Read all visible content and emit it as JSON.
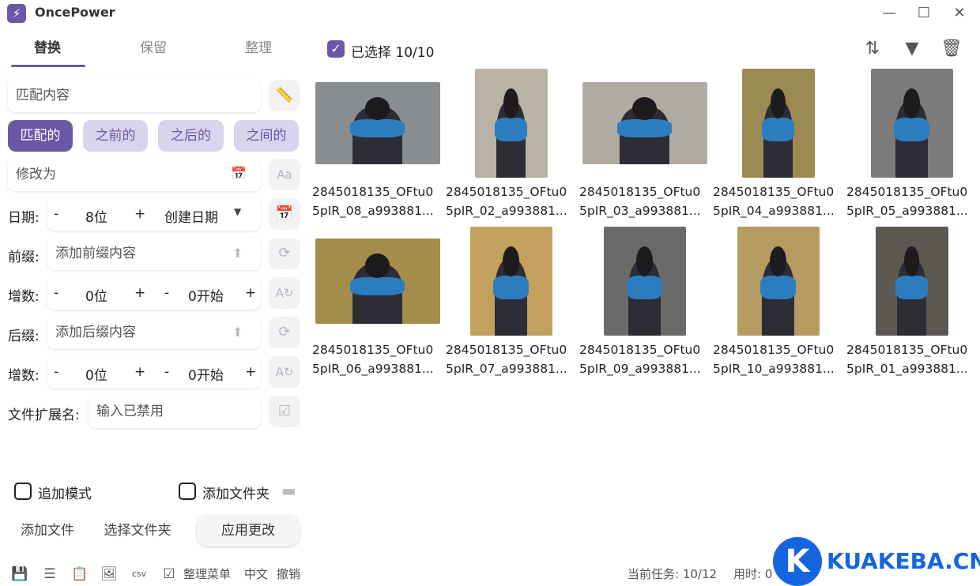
{
  "app": {
    "title": "OncePower",
    "logo_icon": "lightning-icon"
  },
  "window": {
    "minimize": "—",
    "maximize": "☐",
    "close": "✕"
  },
  "tabs": [
    {
      "label": "替换",
      "active": true
    },
    {
      "label": "保留",
      "active": false
    },
    {
      "label": "整理",
      "active": false
    }
  ],
  "form": {
    "match_placeholder": "匹配内容",
    "modes": [
      {
        "label": "匹配的",
        "active": true
      },
      {
        "label": "之前的",
        "active": false
      },
      {
        "label": "之后的",
        "active": false
      },
      {
        "label": "之间的",
        "active": false
      }
    ],
    "replace_placeholder": "修改为",
    "date": {
      "label": "日期:",
      "minus": "-",
      "value": "8位",
      "plus": "+",
      "type": "创建日期"
    },
    "prefix": {
      "label": "前缀:",
      "placeholder": "添加前缀内容"
    },
    "increment1": {
      "label": "增数:",
      "minus": "-",
      "value": "0位",
      "plus": "+",
      "minus2": "-",
      "start": "0开始",
      "plus2": "+"
    },
    "suffix": {
      "label": "后缀:",
      "placeholder": "添加后缀内容"
    },
    "increment2": {
      "label": "增数:",
      "minus": "-",
      "value": "0位",
      "plus": "+",
      "minus2": "-",
      "start": "0开始",
      "plus2": "+"
    },
    "extension": {
      "label": "文件扩展名:",
      "placeholder": "输入已禁用"
    },
    "append_mode": "追加模式",
    "add_folder_check": "添加文件夹",
    "add_file": "添加文件",
    "select_folder": "选择文件夹",
    "apply": "应用更改"
  },
  "selection": {
    "label": "已选择 10/10"
  },
  "files": [
    {
      "line1": "2845018135_OFtu0",
      "line2": "5pIR_08_a993881..."
    },
    {
      "line1": "2845018135_OFtu0",
      "line2": "5pIR_02_a993881..."
    },
    {
      "line1": "2845018135_OFtu0",
      "line2": "5pIR_03_a993881..."
    },
    {
      "line1": "2845018135_OFtu0",
      "line2": "5pIR_04_a993881..."
    },
    {
      "line1": "2845018135_OFtu0",
      "line2": "5pIR_05_a993881..."
    },
    {
      "line1": "2845018135_OFtu0",
      "line2": "5pIR_06_a993881..."
    },
    {
      "line1": "2845018135_OFtu0",
      "line2": "5pIR_07_a993881..."
    },
    {
      "line1": "2845018135_OFtu0",
      "line2": "5pIR_09_a993881..."
    },
    {
      "line1": "2845018135_OFtu0",
      "line2": "5pIR_10_a993881..."
    },
    {
      "line1": "2845018135_OFtu0",
      "line2": "5pIR_01_a993881..."
    }
  ],
  "statusbar": {
    "menu": "整理菜单",
    "language": "中文",
    "undo": "撤销",
    "task": "当前任务: 10/12",
    "time": "用时: 0"
  },
  "watermark": {
    "letter": "K",
    "text": "KUAKEBA.CN"
  },
  "colors": {
    "accent": "#6a58a6",
    "accent_light": "#d9d4ec",
    "scarf": "#2b7dc0",
    "watermark": "#1565e0"
  }
}
